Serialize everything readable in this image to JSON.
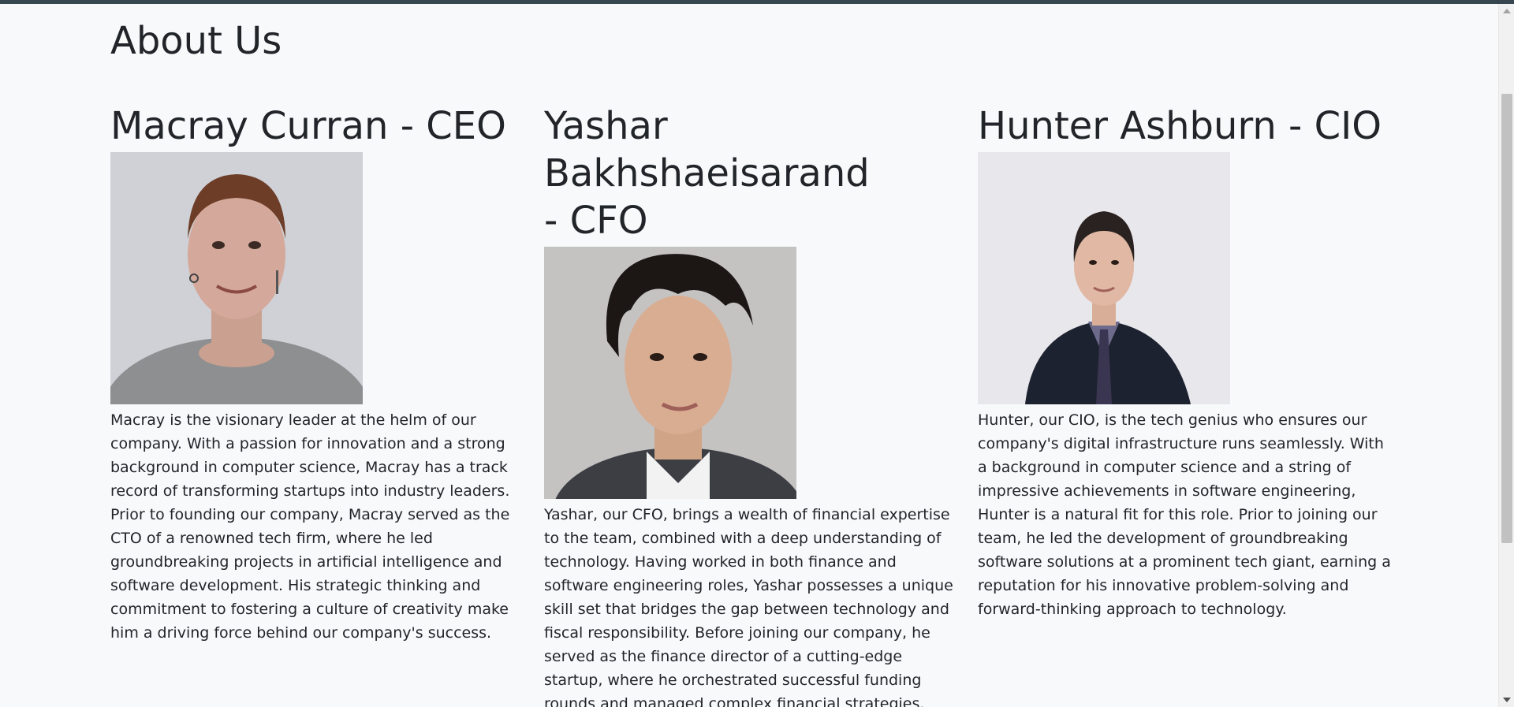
{
  "page": {
    "title": "About Us"
  },
  "members": [
    {
      "name": "Macray Curran - CEO",
      "photo_alt": "Macray Curran",
      "bio": "Macray is the visionary leader at the helm of our company. With a passion for innovation and a strong background in computer science, Macray has a track record of transforming startups into industry leaders. Prior to founding our company, Macray served as the CTO of a renowned tech firm, where he led groundbreaking projects in artificial intelligence and software development. His strategic thinking and commitment to fostering a culture of creativity make him a driving force behind our company's success."
    },
    {
      "name": "Yashar Bakhshaeisarand - CFO",
      "photo_alt": "Yashar Bakhshaeisarand",
      "bio": "Yashar, our CFO, brings a wealth of financial expertise to the team, combined with a deep understanding of technology. Having worked in both finance and software engineering roles, Yashar possesses a unique skill set that bridges the gap between technology and fiscal responsibility. Before joining our company, he served as the finance director of a cutting-edge startup, where he orchestrated successful funding rounds and managed complex financial strategies."
    },
    {
      "name": "Hunter Ashburn - CIO",
      "photo_alt": "Hunter Ashburn",
      "bio": "Hunter, our CIO, is the tech genius who ensures our company's digital infrastructure runs seamlessly. With a background in computer science and a string of impressive achievements in software engineering, Hunter is a natural fit for this role. Prior to joining our team, he led the development of groundbreaking software solutions at a prominent tech giant, earning a reputation for his innovative problem-solving and forward-thinking approach to technology."
    }
  ],
  "colors": {
    "background": "#f8f9fa",
    "text": "#212529",
    "top_bar": "#37474f"
  }
}
